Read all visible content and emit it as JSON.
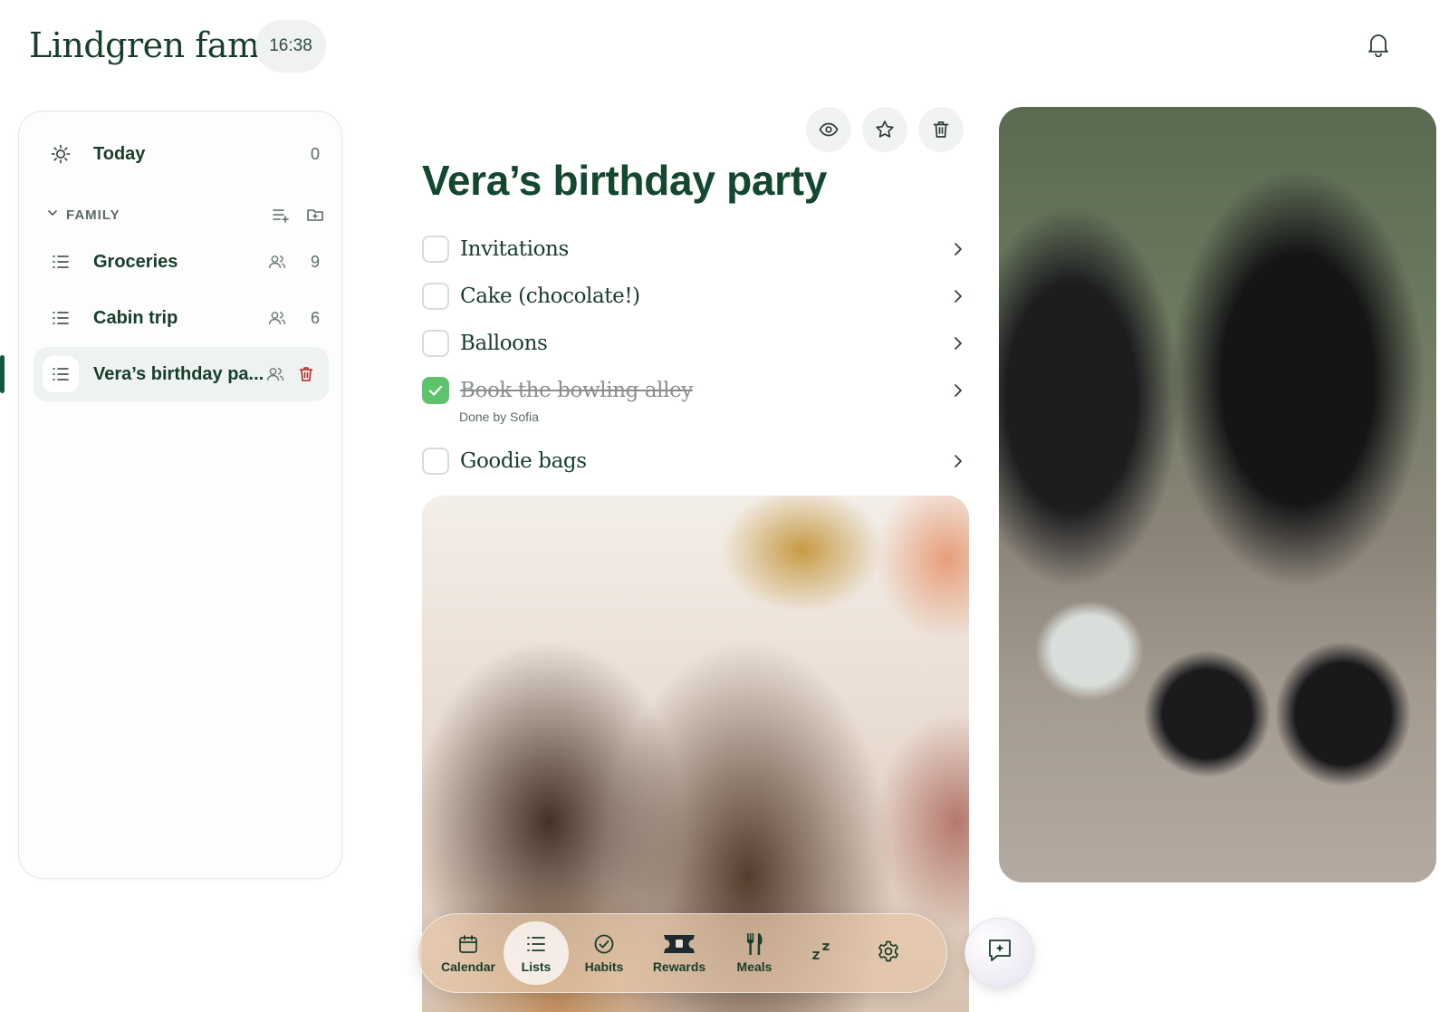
{
  "header": {
    "title": "Lindgren family",
    "time": "16:38",
    "notifications_icon": "bell-icon"
  },
  "sidebar": {
    "today": {
      "label": "Today",
      "count": "0",
      "icon": "sun-icon"
    },
    "section": {
      "label": "FAMILY",
      "icon": "chevron-down-icon"
    },
    "lists": [
      {
        "label": "Groceries",
        "count": "9",
        "icon": "list-icon",
        "shared": true
      },
      {
        "label": "Cabin trip",
        "count": "6",
        "icon": "list-icon",
        "shared": true
      },
      {
        "label": "Vera’s birthday pa...",
        "icon": "list-icon",
        "shared": true,
        "active": true
      }
    ]
  },
  "main": {
    "title": "Vera’s birthday party",
    "actions": [
      "eye-icon",
      "star-icon",
      "trash-icon"
    ],
    "tasks": [
      {
        "text": "Invitations",
        "done": false
      },
      {
        "text": "Cake (chocolate!)",
        "done": false
      },
      {
        "text": "Balloons",
        "done": false
      },
      {
        "text": "Book the bowling alley",
        "done": true,
        "meta": "Done by Sofia"
      },
      {
        "text": "Goodie bags",
        "done": false
      }
    ]
  },
  "dock": {
    "items": [
      {
        "label": "Calendar",
        "icon": "calendar-icon"
      },
      {
        "label": "Lists",
        "icon": "list-icon",
        "active": true
      },
      {
        "label": "Habits",
        "icon": "check-circle-icon"
      },
      {
        "label": "Rewards",
        "icon": "ticket-icon"
      },
      {
        "label": "Meals",
        "icon": "utensils-icon"
      },
      {
        "label": "",
        "icon": "sleep-icon"
      },
      {
        "label": "",
        "icon": "gear-icon"
      }
    ],
    "assistant_icon": "sparkle-chat-icon"
  },
  "colors": {
    "brand_green": "#13472f",
    "check_green": "#5ec46c",
    "delete_red": "#b3261e"
  }
}
